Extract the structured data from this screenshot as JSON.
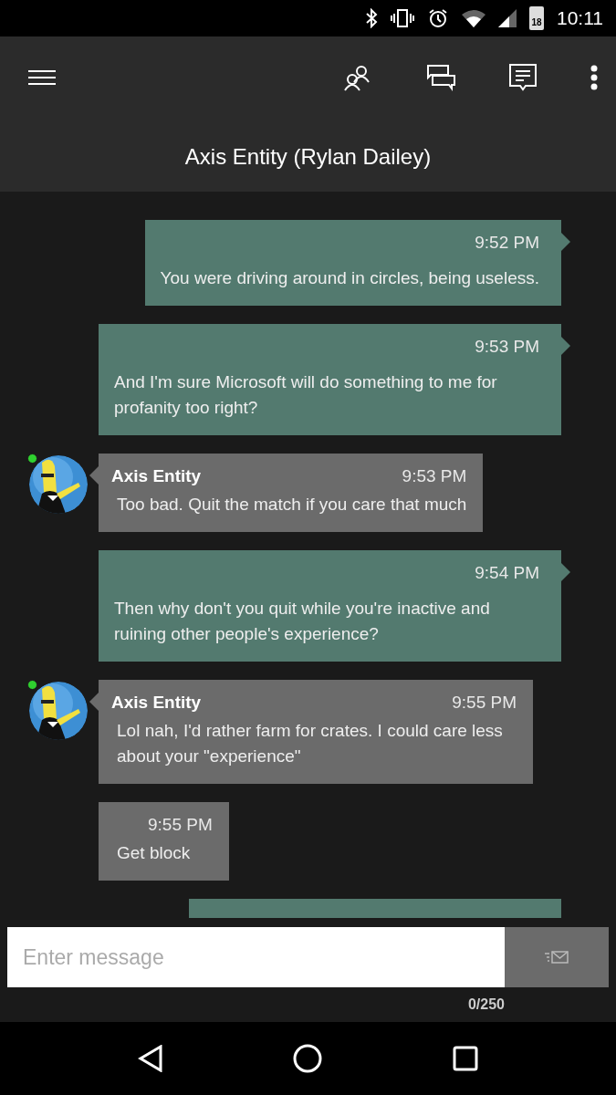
{
  "status_bar": {
    "battery": "18",
    "time": "10:11"
  },
  "app_bar": {
    "title": "Axis Entity (Rylan Dailey)"
  },
  "messages": [
    {
      "kind": "sent",
      "time": "9:52 PM",
      "text": "You were driving around in circles, being useless."
    },
    {
      "kind": "sent",
      "time": "9:53 PM",
      "text": "And I'm sure Microsoft will do something to me for profanity too right?"
    },
    {
      "kind": "received",
      "avatar": true,
      "online": true,
      "sender": "Axis Entity",
      "time": "9:53 PM",
      "text": "Too bad. Quit the match if you care that much"
    },
    {
      "kind": "sent",
      "time": "9:54 PM",
      "text": "Then why don't you quit while you're inactive and ruining other people's experience?"
    },
    {
      "kind": "received",
      "avatar": true,
      "online": true,
      "sender": "Axis Entity",
      "time": "9:55 PM",
      "text": "Lol nah, I'd rather farm for crates. I could care less about your \"experience\""
    },
    {
      "kind": "received",
      "avatar": false,
      "online": false,
      "time": "9:55 PM",
      "text": "Get block"
    },
    {
      "kind": "cut"
    }
  ],
  "composer": {
    "placeholder": "Enter message",
    "counter": "0/250"
  }
}
